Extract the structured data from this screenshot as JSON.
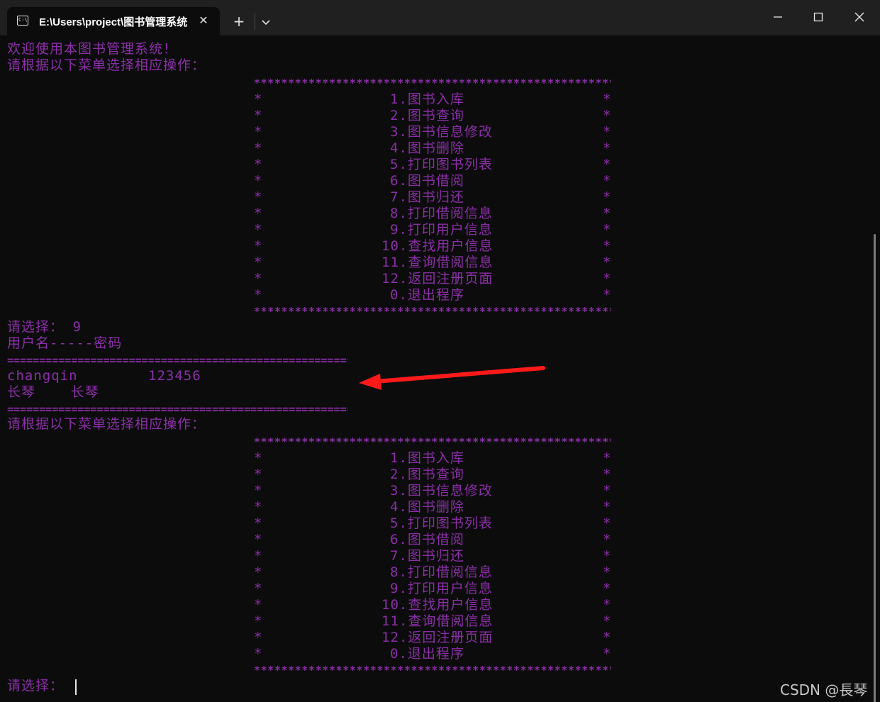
{
  "window": {
    "tab_title": "E:\\Users\\project\\图书管理系统",
    "tab_icon_text": "C:\\",
    "new_tab": "+",
    "close_tab": "✕"
  },
  "terminal": {
    "welcome": "欢迎使用本图书管理系统！",
    "prompt_menu": "请根据以下菜单选择相应操作：",
    "stars": "*******************************************************************",
    "menu_items": [
      "1.图书入库",
      "2.图书查询",
      "3.图书信息修改",
      "4.图书删除",
      "5.打印图书列表",
      "6.图书借阅",
      "7.图书归还",
      "8.打印借阅信息",
      "9.打印用户信息",
      "10.查找用户信息",
      "11.查询借阅信息",
      "12.返回注册页面",
      "0.退出程序"
    ],
    "select_prompt_1": "请选择： 9",
    "user_header": "用户名-----密码",
    "equals": "=================================================================",
    "user_rows": [
      "changqin        123456",
      "长琴    长琴"
    ],
    "select_prompt_2": "请选择："
  },
  "watermark": "CSDN @長琴",
  "colors": {
    "text": "#8b2fa8",
    "background": "#0c0c0c",
    "titlebar": "#202020",
    "arrow": "#ff1a1a"
  }
}
